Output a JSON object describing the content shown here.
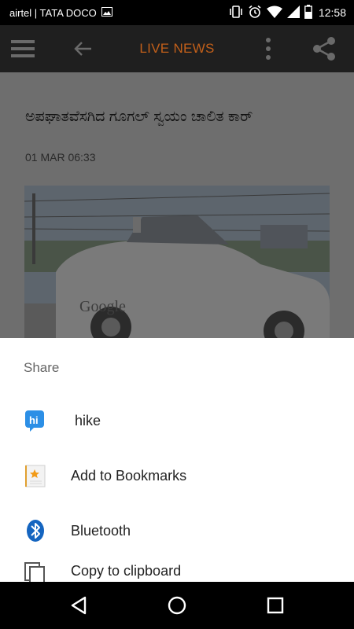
{
  "status_bar": {
    "carrier": "airtel | TATA DOCO",
    "time": "12:58"
  },
  "app_bar": {
    "title": "LIVE NEWS"
  },
  "article": {
    "headline": "ಅಪಘಾತವೆಸಗಿದ ಗೂಗಲ್ ಸ್ವಯಂ ಚಾಲಿತ ಕಾರ್",
    "datetime": "01 MAR 06:33",
    "image_text": "Google"
  },
  "share_sheet": {
    "title": "Share",
    "items": [
      {
        "label": "hike",
        "icon": "hike-icon"
      },
      {
        "label": "Add to Bookmarks",
        "icon": "bookmark-icon"
      },
      {
        "label": "Bluetooth",
        "icon": "bluetooth-icon"
      },
      {
        "label": "Copy to clipboard",
        "icon": "copy-icon"
      }
    ]
  },
  "colors": {
    "title_accent": "#c15f1a",
    "hike_blue": "#2c8fe6",
    "bluetooth_blue": "#1565c0"
  }
}
